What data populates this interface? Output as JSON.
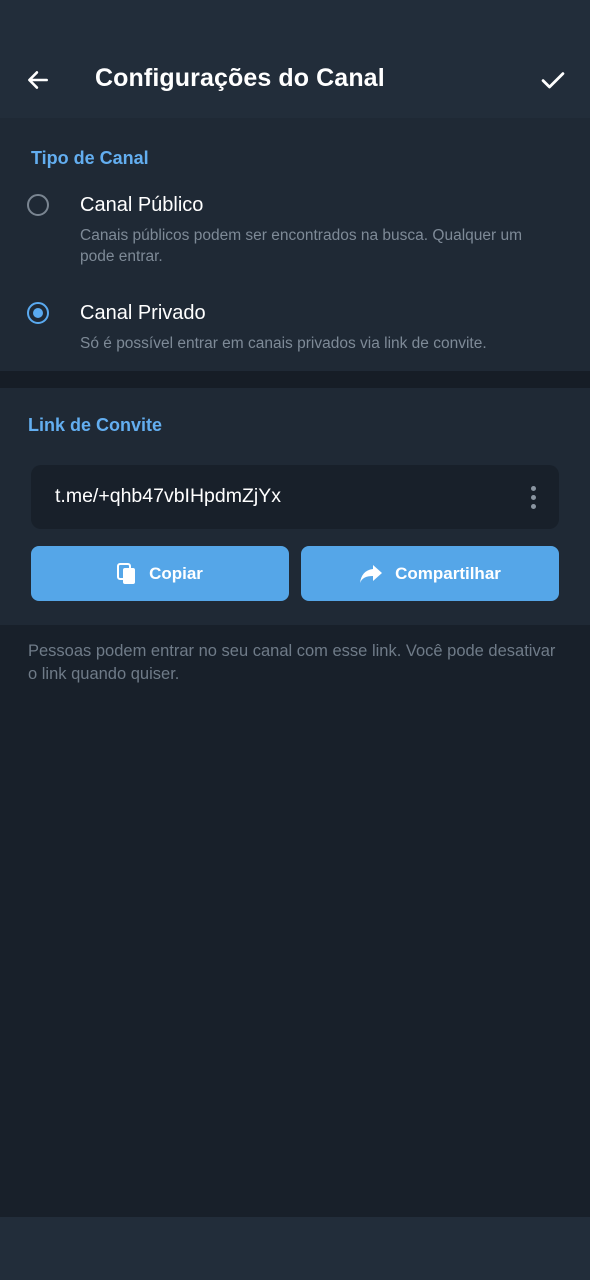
{
  "app_bar": {
    "title": "Configurações do Canal",
    "back_icon": "arrow-left-icon",
    "confirm_icon": "checkmark-icon"
  },
  "channel_type": {
    "header": "Tipo de Canal",
    "options": [
      {
        "label": "Canal Público",
        "description": "Canais públicos podem ser encontrados na busca. Qualquer um pode entrar.",
        "selected": false
      },
      {
        "label": "Canal Privado",
        "description": "Só é possível entrar em canais privados via link de convite.",
        "selected": true
      }
    ]
  },
  "invite_link": {
    "header": "Link de Convite",
    "link": "t.me/+qhb47vbIHpdmZjYx",
    "copy_label": "Copiar",
    "share_label": "Compartilhar",
    "note": "Pessoas podem entrar no seu canal com esse link. Você pode desativar o link quando quiser."
  },
  "colors": {
    "accent": "#5aaaf0",
    "button": "#55a6e8",
    "background": "#18202a",
    "surface": "#1f2935"
  }
}
